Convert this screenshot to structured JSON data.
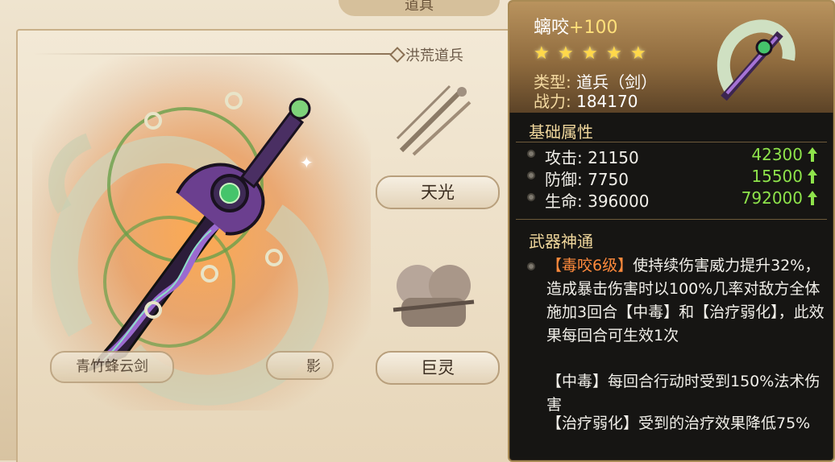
{
  "background": {
    "top_tab": "道具",
    "section_title": "洪荒道兵",
    "items": [
      {
        "label": "天光"
      },
      {
        "label": "巨灵"
      }
    ],
    "left_label": "青竹蜂云剑",
    "partial_label": "影"
  },
  "tooltip": {
    "name": "螭咬",
    "plus": "+100",
    "stars": 5,
    "type_key": "类型:",
    "type_value": "道兵（剑）",
    "power_key": "战力:",
    "power_value": "184170",
    "base_attr_title": "基础属性",
    "stats": [
      {
        "label": "攻击:",
        "base": "21150",
        "bonus": "42300"
      },
      {
        "label": "防御:",
        "base": "7750",
        "bonus": "15500"
      },
      {
        "label": "生命:",
        "base": "396000",
        "bonus": "792000"
      }
    ],
    "skill_title": "武器神通",
    "skill_name": "【毒咬6级】",
    "skill_desc": "使持续伤害威力提升32%，造成暴击伤害时以100%几率对敌方全体施加3回合【中毒】和【治疗弱化】，此效果每回合可生效1次",
    "poison_text": "【中毒】每回合行动时受到150%法术伤害",
    "heal_text": "【治疗弱化】受到的治疗效果降低75%"
  },
  "colors": {
    "accent_gold": "#f0d79c",
    "bonus_green": "#8ee34b",
    "skill_orange": "#ff8a3c",
    "star_yellow": "#ffd84a"
  }
}
